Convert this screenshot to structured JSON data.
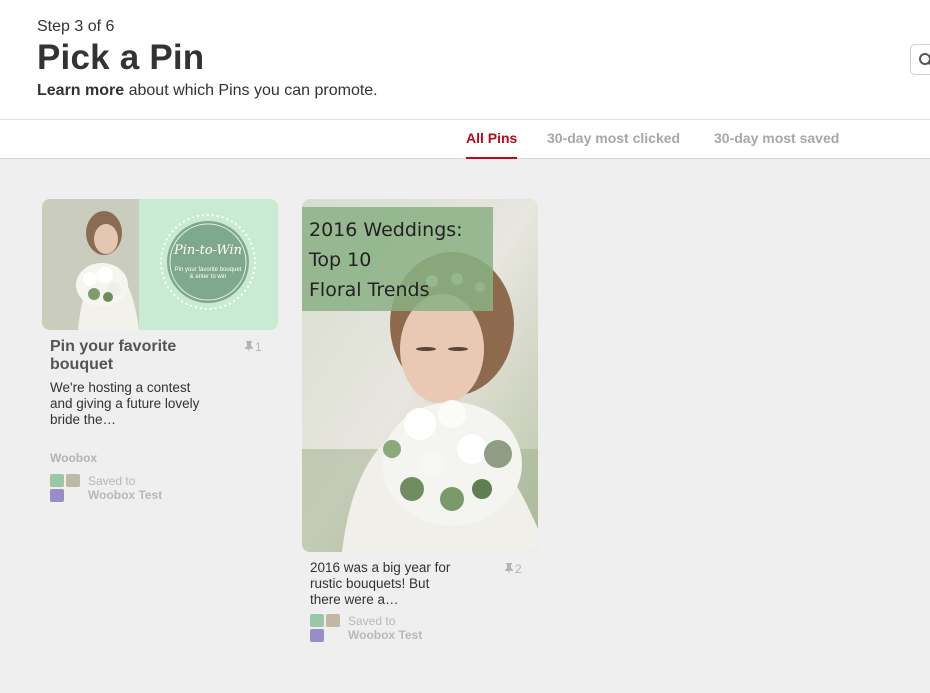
{
  "header": {
    "step": "Step 3 of 6",
    "title": "Pick a Pin",
    "learn_more": "Learn more",
    "learn_more_rest": "about which Pins you can promote."
  },
  "tabs": [
    {
      "label": "All Pins",
      "active": true
    },
    {
      "label": "30-day most clicked",
      "active": false
    },
    {
      "label": "30-day most saved",
      "active": false
    }
  ],
  "pins": [
    {
      "title": "Pin your favorite bouquet",
      "description": "We're hosting a contest and giving a future lovely bride the…",
      "save_count": "1",
      "source": "Woobox",
      "saved_label": "Saved to",
      "board": "Woobox Test",
      "image": {
        "badge_title": "Pin-to-Win",
        "badge_subtitle": "Pin your favorite bouquet & enter to win",
        "bg_color": "#c9ead3"
      }
    },
    {
      "title": "",
      "description": "2016 was a big year for rustic bouquets! But there were a…",
      "save_count": "2",
      "source": "",
      "saved_label": "Saved to",
      "board": "Woobox Test",
      "image": {
        "overlay_text": [
          "2016 Weddings:",
          "Top 10",
          "Floral Trends"
        ],
        "overlay_color": "#8ab084"
      }
    }
  ],
  "colors": {
    "accent": "#bd081c",
    "muted_text": "#a7a7a7",
    "grid_bg": "#efefef"
  }
}
